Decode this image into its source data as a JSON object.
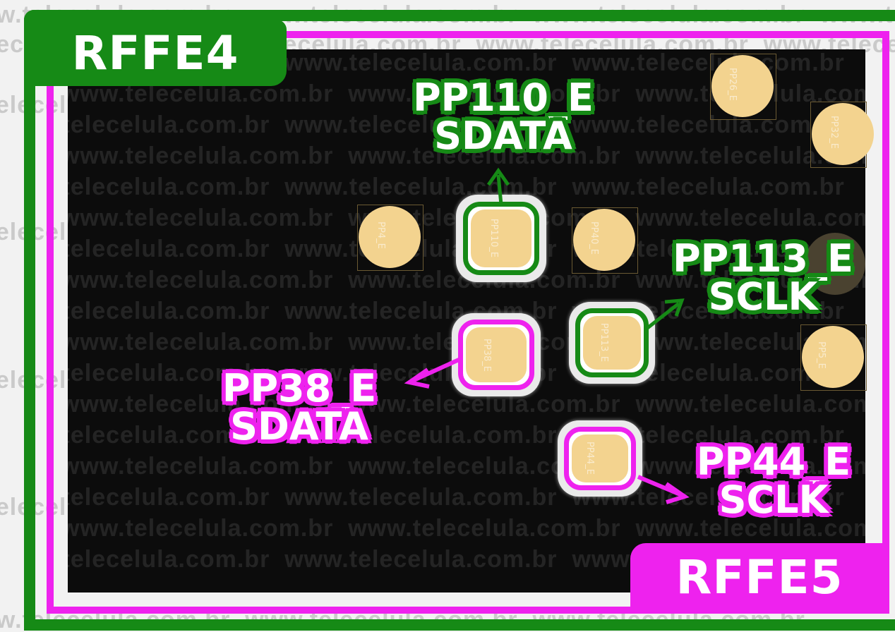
{
  "watermark": "www.telecelula.com.br",
  "colors": {
    "green": "#168a16",
    "magenta": "#ee22ee",
    "pad": "#f3d38f",
    "board": "#0c0c0c"
  },
  "tags": {
    "rffe4": "RFFE4",
    "rffe5": "RFFE5"
  },
  "callouts": {
    "pp110": {
      "line1": "PP110_E",
      "line2": "SDATA"
    },
    "pp113": {
      "line1": "PP113_E",
      "line2": "SCLK"
    },
    "pp38": {
      "line1": "PP38_E",
      "line2": "SDATA"
    },
    "pp44": {
      "line1": "PP44_E",
      "line2": "SCLK"
    }
  },
  "pad_labels": {
    "pp110": "PP110_E",
    "pp113": "PP113_E",
    "pp38": "PP38_E",
    "pp44": "PP44_E",
    "pp40": "PP40_E",
    "pp_left": "PP4_E",
    "pp_tr1": "PP26_E",
    "pp_tr2": "PP32_E",
    "pp_r3": "PP5_E"
  }
}
